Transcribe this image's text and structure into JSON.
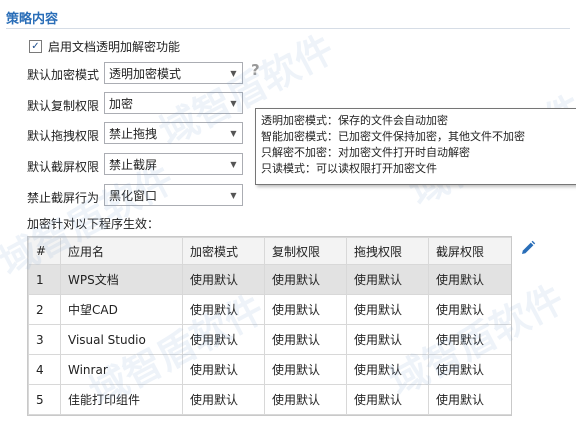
{
  "section": {
    "title": "策略内容",
    "enable_label": "启用文档透明加解密功能",
    "enable_checked": true
  },
  "settings": {
    "encrypt_mode_label": "默认加密模式",
    "encrypt_mode_value": "透明加密模式",
    "copy_label": "默认复制权限",
    "copy_value": "加密",
    "drag_label": "默认拖拽权限",
    "drag_value": "禁止拖拽",
    "screenshot_label": "默认截屏权限",
    "screenshot_value": "禁止截屏",
    "block_label": "禁止截屏行为",
    "block_value": "黑化窗口"
  },
  "tooltip": {
    "line1": "透明加密模式：保存的文件会自动加密",
    "line2": "智能加密模式：已加密文件保持加密，其他文件不加密",
    "line3": "只解密不加密：对加密文件打开时自动解密",
    "line4": "只读模式：可以读权限打开加密文件"
  },
  "table": {
    "caption": "加密针对以下程序生效：",
    "headers": [
      "#",
      "应用名",
      "加密模式",
      "复制权限",
      "拖拽权限",
      "截屏权限"
    ],
    "rows": [
      [
        "1",
        "WPS文档",
        "使用默认",
        "使用默认",
        "使用默认",
        "使用默认"
      ],
      [
        "2",
        "中望CAD",
        "使用默认",
        "使用默认",
        "使用默认",
        "使用默认"
      ],
      [
        "3",
        "Visual Studio",
        "使用默认",
        "使用默认",
        "使用默认",
        "使用默认"
      ],
      [
        "4",
        "Winrar",
        "使用默认",
        "使用默认",
        "使用默认",
        "使用默认"
      ],
      [
        "5",
        "佳能打印组件",
        "使用默认",
        "使用默认",
        "使用默认",
        "使用默认"
      ]
    ],
    "selected_row": 0
  },
  "watermark": {
    "text": "域智盾软件"
  },
  "icons": {
    "help": "help-icon",
    "edit": "edit-pencil-icon"
  },
  "colors": {
    "title": "#2a6eb8",
    "edit_icon": "#2a6eb8"
  }
}
